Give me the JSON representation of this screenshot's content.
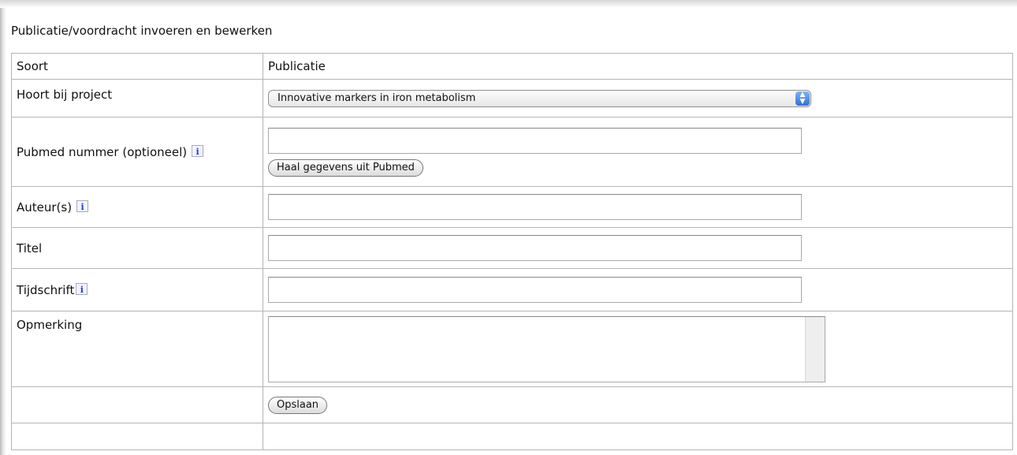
{
  "page_title": "Publicatie/voordracht invoeren en bewerken",
  "rows": {
    "soort": {
      "label": "Soort",
      "value": "Publicatie"
    },
    "project": {
      "label": "Hoort bij project",
      "selected": "Innovative markers in iron metabolism"
    },
    "pubmed": {
      "label": "Pubmed nummer (optioneel)",
      "value": "",
      "button": "Haal gegevens uit Pubmed"
    },
    "auteurs": {
      "label": "Auteur(s)",
      "value": ""
    },
    "titel": {
      "label": "Titel",
      "value": ""
    },
    "tijdschrift": {
      "label": "Tijdschrift",
      "value": ""
    },
    "opmerking": {
      "label": "Opmerking",
      "value": ""
    }
  },
  "buttons": {
    "save": "Opslaan"
  },
  "icons": {
    "info": "info-icon",
    "select_arrows": "updown-arrows-icon"
  },
  "colors": {
    "info_icon": "#1d3fd6",
    "select_accent": "#2f6fd8",
    "table_border": "#b5b5b5"
  }
}
